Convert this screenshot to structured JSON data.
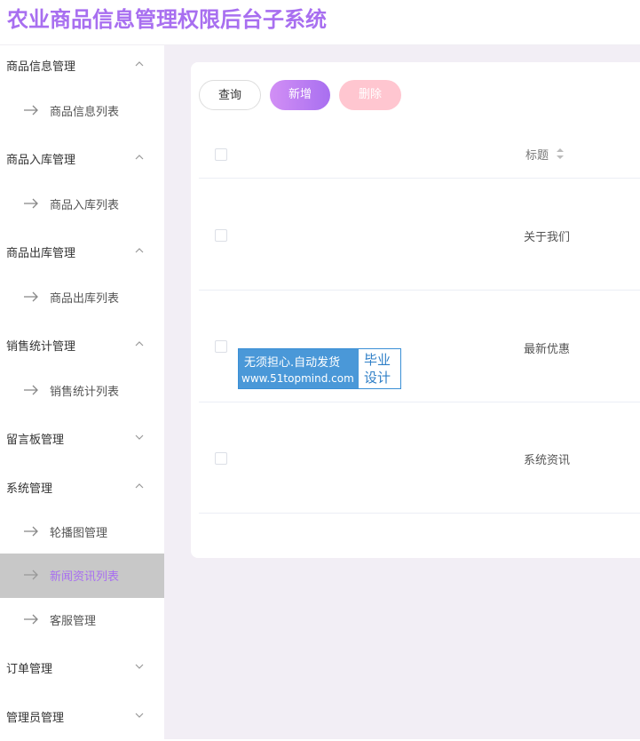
{
  "app": {
    "title": "农业商品信息管理权限后台子系统"
  },
  "sidebar": {
    "groups": [
      {
        "label": "商品信息管理",
        "expanded": true,
        "items": [
          {
            "label": "商品信息列表"
          }
        ]
      },
      {
        "label": "商品入库管理",
        "expanded": true,
        "items": [
          {
            "label": "商品入库列表"
          }
        ]
      },
      {
        "label": "商品出库管理",
        "expanded": true,
        "items": [
          {
            "label": "商品出库列表"
          }
        ]
      },
      {
        "label": "销售统计管理",
        "expanded": true,
        "items": [
          {
            "label": "销售统计列表"
          }
        ]
      },
      {
        "label": "留言板管理",
        "expanded": false,
        "items": []
      },
      {
        "label": "系统管理",
        "expanded": true,
        "items": [
          {
            "label": "轮播图管理"
          },
          {
            "label": "新闻资讯列表",
            "active": true
          },
          {
            "label": "客服管理"
          }
        ]
      },
      {
        "label": "订单管理",
        "expanded": false,
        "items": []
      },
      {
        "label": "管理员管理",
        "expanded": false,
        "items": []
      }
    ]
  },
  "toolbar": {
    "query_label": "查询",
    "add_label": "新增",
    "delete_label": "删除"
  },
  "table": {
    "headers": {
      "title": "标题"
    },
    "rows": [
      {
        "title": "关于我们"
      },
      {
        "title": "最新优惠"
      },
      {
        "title": "系统资讯"
      }
    ]
  },
  "watermark": {
    "line1": "无须担心.自动发货",
    "line2": "www.51topmind.com",
    "right1": "毕业",
    "right2": "设计"
  },
  "colors": {
    "accent": "#a86ff0",
    "content_bg": "#f2eef5",
    "active_item_bg": "#c8c8c8",
    "delete_btn": "#ffc6d0"
  }
}
